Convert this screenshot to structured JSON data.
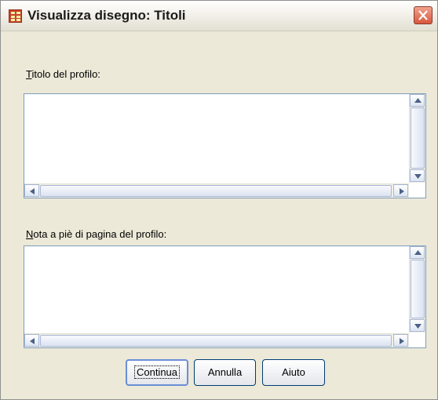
{
  "window": {
    "title": "Visualizza disegno: Titoli"
  },
  "fields": {
    "title_label_mnemonic": "T",
    "title_label_rest": "itolo del profilo:",
    "title_value": "",
    "footnote_label_mnemonic": "N",
    "footnote_label_rest": "ota a piè di pagina del profilo:",
    "footnote_value": ""
  },
  "buttons": {
    "continue": "Continua",
    "cancel": "Annulla",
    "help": "Aiuto"
  },
  "icons": {
    "app": "spreadsheet-icon",
    "close": "close-icon"
  },
  "colors": {
    "close_button": "#d8573c",
    "app_icon": "#c8432b",
    "window_bg": "#ece9d8"
  }
}
